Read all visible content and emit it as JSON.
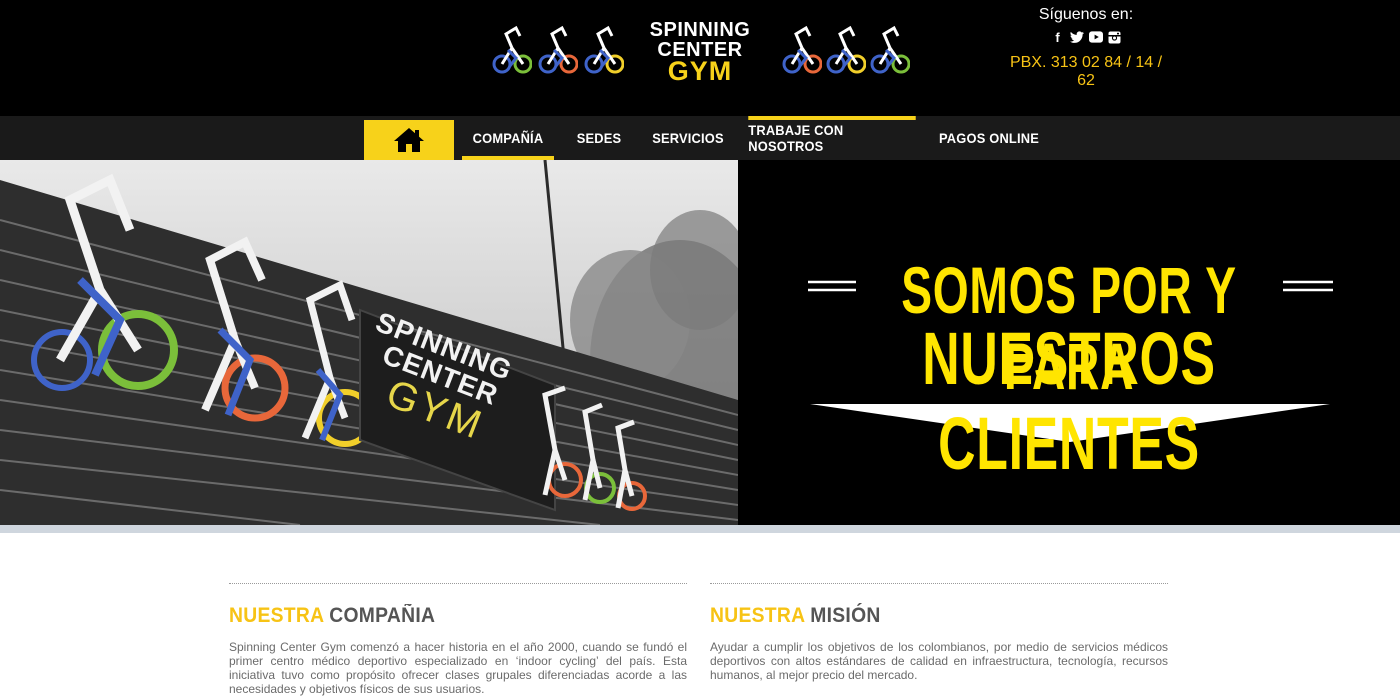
{
  "header": {
    "logo": {
      "line1": "SPINNING",
      "line2": "CENTER",
      "line3": "GYM"
    },
    "social": {
      "label": "Síguenos en:",
      "icons": [
        "facebook-icon",
        "twitter-icon",
        "youtube-icon",
        "instagram-icon"
      ]
    },
    "phone": "PBX. 313 02 84 / 14 / 62"
  },
  "nav": {
    "home_icon": "home-icon",
    "items": [
      {
        "label": "COMPAÑÍA"
      },
      {
        "label": "SEDES"
      },
      {
        "label": "SERVICIOS"
      },
      {
        "label": "TRABAJE CON NOSOTROS"
      },
      {
        "label": "PAGOS ONLINE"
      }
    ]
  },
  "hero": {
    "sign": {
      "line1": "SPINNING",
      "line2": "CENTER",
      "line3": "GYM"
    },
    "slogan_line1": "SOMOS POR Y PARA",
    "slogan_line2": "NUESTROS CLIENTES"
  },
  "sections": [
    {
      "title_highlight": "NUESTRA",
      "title_rest": "COMPAÑIA",
      "text": "Spinning Center Gym comenzó a hacer historia en el año 2000, cuando se fundó el primer centro médico deportivo especializado en ‘indoor cycling’ del país. Esta iniciativa tuvo como propósito ofrecer clases grupales diferenciadas acorde a las necesidades y objetivos físicos de sus usuarios."
    },
    {
      "title_highlight": "NUESTRA",
      "title_rest": "MISIÓN",
      "text": "Ayudar a cumplir los objetivos de los colombianos, por medio de servicios médicos deportivos con altos estándares de calidad en infraestructura, tecnología, recursos humanos, al mejor precio del mercado."
    }
  ],
  "colors": {
    "brand_yellow": "#f7d21a",
    "phone_yellow": "#f7c315",
    "slogan_yellow": "#ffe500",
    "bike_blue": "#3f63c9",
    "wheel_green": "#7bbf3a",
    "wheel_orange": "#e8673a",
    "wheel_yellow": "#f1cf2a"
  }
}
